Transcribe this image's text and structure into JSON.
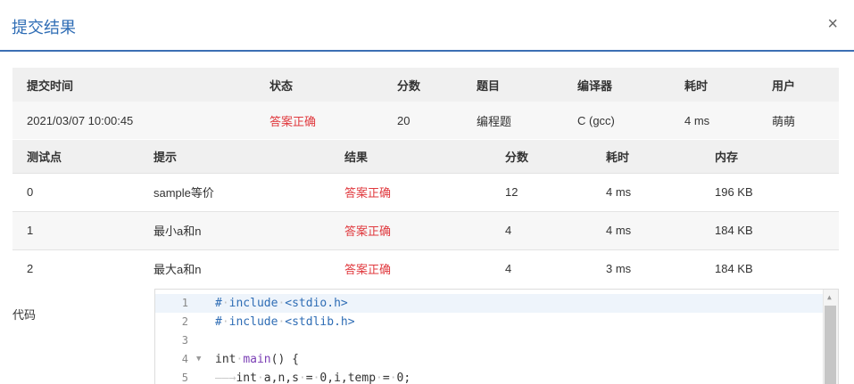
{
  "dialog": {
    "title": "提交结果",
    "close": "×"
  },
  "summary": {
    "headers": [
      "提交时间",
      "状态",
      "分数",
      "题目",
      "编译器",
      "耗时",
      "用户"
    ],
    "row": [
      "2021/03/07 10:00:45",
      "答案正确",
      "20",
      "编程题",
      "C (gcc)",
      "4 ms",
      "萌萌"
    ]
  },
  "cases": {
    "headers": [
      "测试点",
      "提示",
      "结果",
      "分数",
      "耗时",
      "内存"
    ],
    "rows": [
      [
        "0",
        "sample等价",
        "答案正确",
        "12",
        "4 ms",
        "196 KB"
      ],
      [
        "1",
        "最小a和n",
        "答案正确",
        "4",
        "4 ms",
        "184 KB"
      ],
      [
        "2",
        "最大a和n",
        "答案正确",
        "4",
        "3 ms",
        "184 KB"
      ]
    ]
  },
  "code": {
    "label": "代码",
    "line_numbers": [
      "1",
      "2",
      "3",
      "4",
      "5"
    ],
    "fold_marker": "▼",
    "tokens": {
      "hash": "#",
      "include": "include",
      "stdio": "<stdio.h>",
      "stdlib": "<stdlib.h>",
      "int": "int",
      "main": "main",
      "main_rest": "() {",
      "vars": "a,n,s",
      "eq": "=",
      "zero": "0",
      "vars2": ",i,temp",
      "semi": ";",
      "ws_dot": "·",
      "tab_arrow": "——→"
    }
  },
  "colors": {
    "accent": "#2f6db5",
    "success_red": "#e0393e",
    "header_bg": "#f0f0f0",
    "stripe_bg": "#f7f7f7"
  }
}
